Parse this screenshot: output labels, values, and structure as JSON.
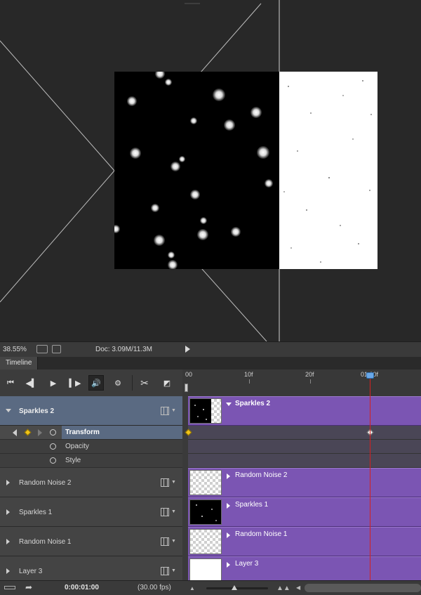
{
  "status_bar": {
    "zoom": "38.55%",
    "doc_info": "Doc: 3.09M/11.3M"
  },
  "timeline": {
    "tab_label": "Timeline",
    "ruler": {
      "ticks": [
        "00",
        "10f",
        "20f",
        "01:00f"
      ]
    },
    "layers": [
      {
        "name": "Sparkles 2",
        "expanded": true,
        "selected": true
      },
      {
        "name": "Random Noise 2",
        "expanded": false
      },
      {
        "name": "Sparkles 1",
        "expanded": false
      },
      {
        "name": "Random Noise 1",
        "expanded": false
      },
      {
        "name": "Layer 3",
        "expanded": false
      }
    ],
    "properties": [
      {
        "name": "Transform",
        "highlighted": true
      },
      {
        "name": "Opacity"
      },
      {
        "name": "Style"
      }
    ],
    "clips": [
      "Sparkles 2",
      "Random Noise 2",
      "Sparkles 1",
      "Random Noise 1",
      "Layer 3"
    ],
    "current_time": "0:00:01:00",
    "fps": "(30.00 fps)"
  },
  "colors": {
    "clip": "#7b55b3",
    "selected_layer": "#5a6a82",
    "playhead": "#d42020",
    "keyframe": "#f0c419"
  }
}
